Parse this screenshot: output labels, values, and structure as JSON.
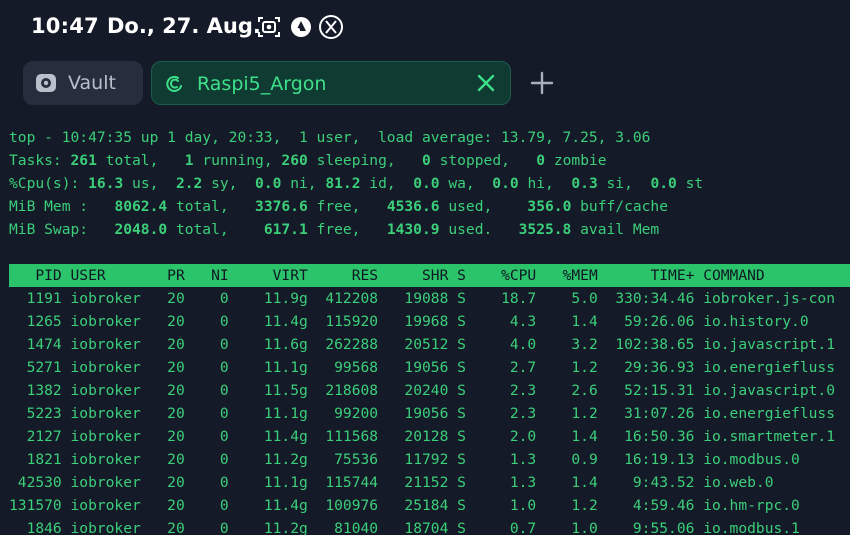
{
  "status_bar": {
    "time": "10:47",
    "date": "Do., 27. Aug."
  },
  "tabs": [
    {
      "label": "Vault",
      "active": false
    },
    {
      "label": "Raspi5_Argon",
      "active": true
    }
  ],
  "colors": {
    "accent": "#2bc46a",
    "background": "#141a28",
    "active_tab": "#0f3b33"
  },
  "terminal": {
    "top_line": "top - 10:47:35 up 1 day, 20:33,  1 user,  load average: 13.79, 7.25, 3.06",
    "tasks": {
      "label": "Tasks:",
      "total": "261",
      "running": "1",
      "sleeping": "260",
      "stopped": "0",
      "zombie": "0"
    },
    "cpu": {
      "label": "%Cpu(s):",
      "us": "16.3",
      "sy": "2.2",
      "ni": "0.0",
      "id": "81.2",
      "wa": "0.0",
      "hi": "0.0",
      "si": "0.3",
      "st": "0.0"
    },
    "mem": {
      "label": "MiB Mem :",
      "total": "8062.4",
      "free": "3376.6",
      "used": "4536.6",
      "buff_cache": "356.0"
    },
    "swap": {
      "label": "MiB Swap:",
      "total": "2048.0",
      "free": "617.1",
      "used": "1430.9",
      "avail": "3525.8"
    },
    "columns": [
      "PID",
      "USER",
      "PR",
      "NI",
      "VIRT",
      "RES",
      "SHR",
      "S",
      "%CPU",
      "%MEM",
      "TIME+",
      "COMMAND"
    ],
    "processes": [
      [
        "1191",
        "iobroker",
        "20",
        "0",
        "11.9g",
        "412208",
        "19088",
        "S",
        "18.7",
        "5.0",
        "330:34.46",
        "iobroker.js-con"
      ],
      [
        "1265",
        "iobroker",
        "20",
        "0",
        "11.4g",
        "115920",
        "19968",
        "S",
        "4.3",
        "1.4",
        "59:26.06",
        "io.history.0"
      ],
      [
        "1474",
        "iobroker",
        "20",
        "0",
        "11.6g",
        "262288",
        "20512",
        "S",
        "4.0",
        "3.2",
        "102:38.65",
        "io.javascript.1"
      ],
      [
        "5271",
        "iobroker",
        "20",
        "0",
        "11.1g",
        "99568",
        "19056",
        "S",
        "2.7",
        "1.2",
        "29:36.93",
        "io.energiefluss"
      ],
      [
        "1382",
        "iobroker",
        "20",
        "0",
        "11.5g",
        "218608",
        "20240",
        "S",
        "2.3",
        "2.6",
        "52:15.31",
        "io.javascript.0"
      ],
      [
        "5223",
        "iobroker",
        "20",
        "0",
        "11.1g",
        "99200",
        "19056",
        "S",
        "2.3",
        "1.2",
        "31:07.26",
        "io.energiefluss"
      ],
      [
        "2127",
        "iobroker",
        "20",
        "0",
        "11.4g",
        "111568",
        "20128",
        "S",
        "2.0",
        "1.4",
        "16:50.36",
        "io.smartmeter.1"
      ],
      [
        "1821",
        "iobroker",
        "20",
        "0",
        "11.2g",
        "75536",
        "11792",
        "S",
        "1.3",
        "0.9",
        "16:19.13",
        "io.modbus.0"
      ],
      [
        "42530",
        "iobroker",
        "20",
        "0",
        "11.1g",
        "115744",
        "21152",
        "S",
        "1.3",
        "1.4",
        "9:43.52",
        "io.web.0"
      ],
      [
        "131570",
        "iobroker",
        "20",
        "0",
        "11.4g",
        "100976",
        "25184",
        "S",
        "1.0",
        "1.2",
        "4:59.46",
        "io.hm-rpc.0"
      ],
      [
        "1846",
        "iobroker",
        "20",
        "0",
        "11.2g",
        "81040",
        "18704",
        "S",
        "0.7",
        "1.0",
        "9:55.06",
        "io.modbus.1"
      ]
    ]
  }
}
